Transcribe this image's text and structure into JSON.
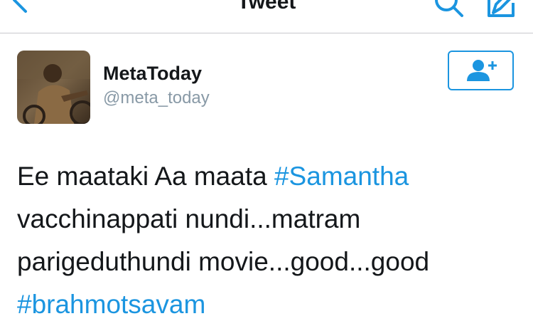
{
  "navbar": {
    "title": "Tweet",
    "back_icon": "chevron-left-icon",
    "search_icon": "search-icon",
    "compose_icon": "compose-icon"
  },
  "author": {
    "display_name": "MetaToday",
    "handle": "@meta_today",
    "follow_icon": "add-user-icon"
  },
  "tweet": {
    "line1_text": "Ee maataki Aa maata ",
    "line1_hashtag": "#Samantha",
    "line2": "vacchinappati nundi...matram",
    "line3": "parigeduthundi movie...good...good",
    "hashtag2": "#brahmotsavam"
  },
  "colors": {
    "accent": "#1b95e0",
    "text": "#14171a",
    "secondary_text": "#8899a6",
    "divider": "#c8c8cc"
  }
}
